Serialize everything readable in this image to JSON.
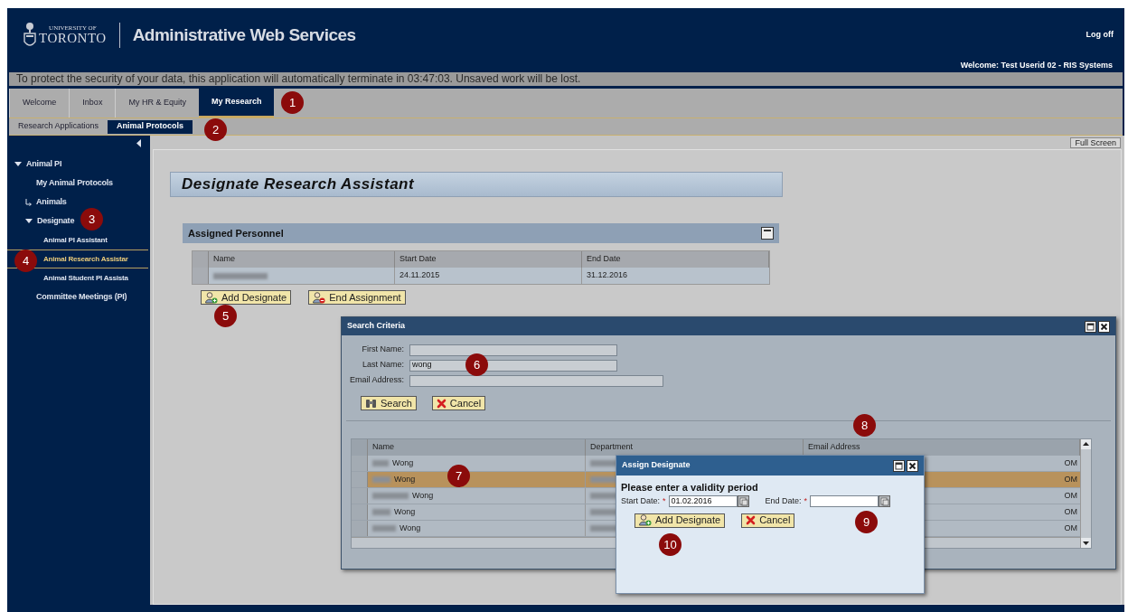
{
  "header": {
    "logo_small": "UNIVERSITY OF",
    "logo_big": "TORONTO",
    "app_title": "Administrative Web Services",
    "log_off": "Log off",
    "welcome": "Welcome: Test Userid 02 - RIS Systems"
  },
  "banner": "To protect the security of your data, this application will automatically terminate in 03:47:03. Unsaved work will be lost.",
  "tabs": [
    {
      "label": "Welcome",
      "selected": false
    },
    {
      "label": "Inbox",
      "selected": false
    },
    {
      "label": "My HR & Equity",
      "selected": false
    },
    {
      "label": "My Research",
      "selected": true
    }
  ],
  "subtabs": [
    {
      "label": "Research Applications",
      "selected": false
    },
    {
      "label": "Animal Protocols",
      "selected": true
    }
  ],
  "sidebar": {
    "items": [
      {
        "label": "Animal PI",
        "kind": "folder",
        "expanded": true,
        "selected": false,
        "children": [
          {
            "label": "My Animal Protocols",
            "kind": "leaf",
            "selected": false
          },
          {
            "label": "Animals",
            "kind": "folder",
            "expanded": false,
            "selected": false
          },
          {
            "label": "Designate",
            "kind": "folder",
            "expanded": true,
            "selected": false,
            "children": [
              {
                "label": "Animal PI Assistant",
                "kind": "leaf",
                "selected": false
              },
              {
                "label": "Animal Research Assistar",
                "kind": "leaf",
                "selected": true
              },
              {
                "label": "Animal Student PI Assista",
                "kind": "leaf",
                "selected": false
              }
            ]
          },
          {
            "label": "Committee Meetings (PI)",
            "kind": "leaf",
            "selected": false
          }
        ]
      }
    ]
  },
  "full_screen": "Full Screen",
  "page_title": "Designate Research Assistant",
  "assigned": {
    "title": "Assigned Personnel",
    "columns": [
      "Name",
      "Start Date",
      "End Date"
    ],
    "rows": [
      {
        "start": "24.11.2015",
        "end": "31.12.2016"
      }
    ],
    "buttons": [
      {
        "label": "Add Designate",
        "kind": "add"
      },
      {
        "label": "End Assignment",
        "kind": "remove"
      }
    ]
  },
  "search_dialog": {
    "title": "Search Criteria",
    "fields": [
      {
        "label": "First Name:"
      },
      {
        "label": "Last Name:",
        "value": "wong"
      },
      {
        "label": "Email Address:"
      }
    ],
    "buttons": [
      {
        "label": "Search",
        "kind": "search"
      },
      {
        "label": "Cancel",
        "kind": "cancel"
      }
    ],
    "columns": [
      "Name",
      "Department",
      "Email Address"
    ],
    "rows": [
      {
        "name": "Wong",
        "email": "OM",
        "selected": false
      },
      {
        "name": "Wong",
        "email": "OM",
        "selected": true
      },
      {
        "name": "Wong",
        "email": "OM",
        "selected": false
      },
      {
        "name": "Wong",
        "email": "OM",
        "selected": false
      },
      {
        "name": "Wong",
        "email": "OM",
        "selected": false
      }
    ]
  },
  "assign_dialog": {
    "title": "Assign Designate",
    "heading": "Please enter a validity period",
    "fields": [
      {
        "label": "Start Date:",
        "required": true,
        "value": "01.02.2016"
      },
      {
        "label": "End Date:",
        "required": true
      }
    ],
    "required_mark": "*",
    "buttons": [
      {
        "label": "Add Designate",
        "kind": "add"
      },
      {
        "label": "Cancel",
        "kind": "cancel"
      }
    ]
  },
  "callouts": [
    "1",
    "2",
    "3",
    "4",
    "5",
    "6",
    "7",
    "8",
    "9",
    "10"
  ]
}
